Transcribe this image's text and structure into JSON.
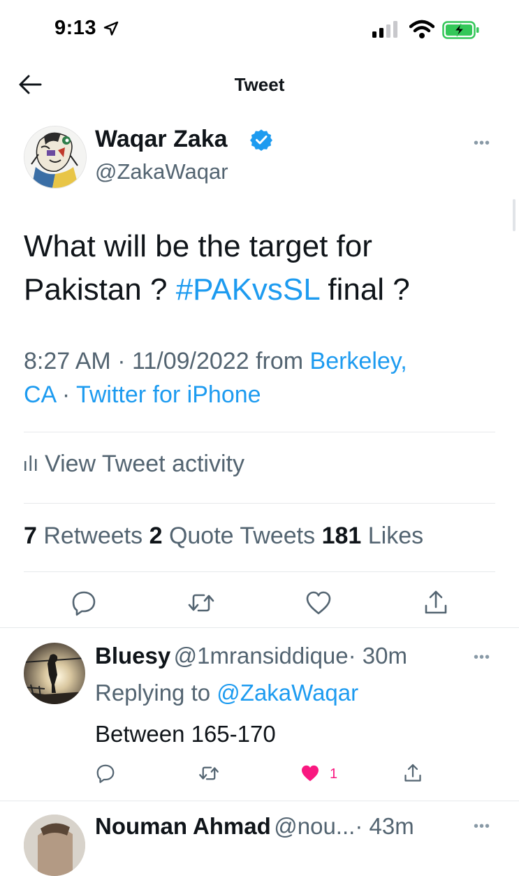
{
  "status_bar": {
    "time": "9:13"
  },
  "header": {
    "title": "Tweet"
  },
  "tweet": {
    "author_name": "Waqar Zaka",
    "author_handle": "@ZakaWaqar",
    "text_part1": "What will be the target for Pakistan ? ",
    "hashtag": "#PAKvsSL",
    "text_part2": " final ?",
    "timestamp": "8:27 AM · 11/09/2022",
    "from_label": "from",
    "location_line1": "Berkeley,",
    "location_line2": "CA",
    "separator": "·",
    "source": "Twitter for iPhone",
    "activity_label": "View Tweet activity",
    "stats": {
      "retweets_count": "7",
      "retweets_label": "Retweets",
      "quotes_count": "2",
      "quotes_label": "Quote Tweets",
      "likes_count": "181",
      "likes_label": "Likes"
    }
  },
  "replies": [
    {
      "name": "Bluesy",
      "handle": "@1mransiddique",
      "time": "· 30m",
      "replying_prefix": "Replying to",
      "replying_to": "@ZakaWaqar",
      "text": "Between 165-170",
      "like_count": "1"
    },
    {
      "name": "Nouman Ahmad",
      "handle": "@nou...",
      "time": "· 43m"
    }
  ],
  "icons": {
    "back": "arrow-left-icon",
    "verified": "verified-badge-icon",
    "reply": "reply-icon",
    "retweet": "retweet-icon",
    "like": "heart-icon",
    "share": "share-icon",
    "more": "more-icon"
  },
  "colors": {
    "accent": "#1d9bf0",
    "like": "#f91880",
    "secondary_text": "#536471",
    "battery_green": "#34c759"
  }
}
